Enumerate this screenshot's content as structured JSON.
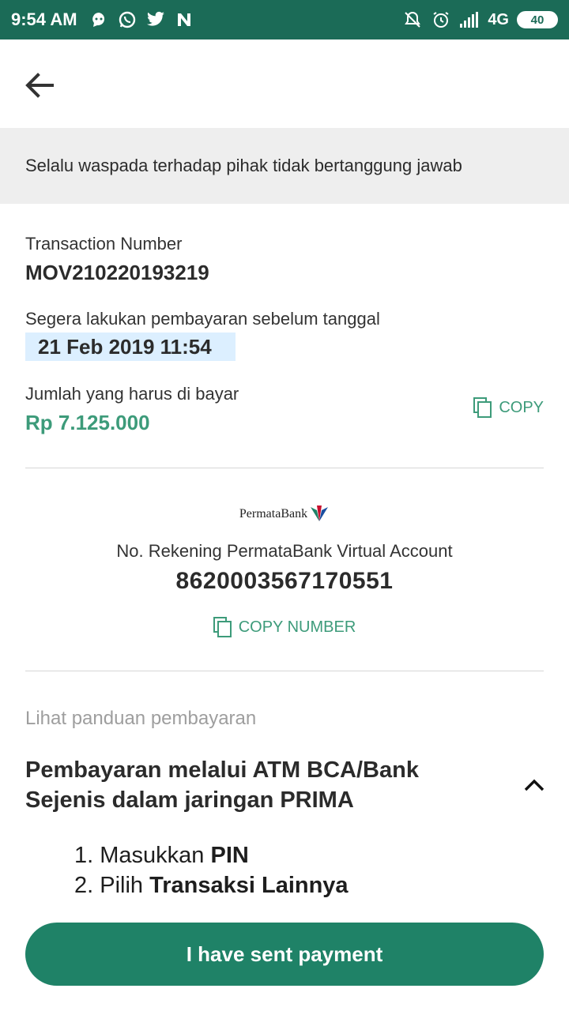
{
  "status_bar": {
    "time": "9:54 AM",
    "network": "4G",
    "battery": "40",
    "left_icons": [
      "chat-icon",
      "whatsapp-icon",
      "twitter-icon",
      "n-app-icon"
    ],
    "right_icons": [
      "notifications-off-icon",
      "alarm-icon",
      "signal-icon"
    ]
  },
  "banner": {
    "text": "Selalu waspada terhadap pihak tidak bertanggung jawab"
  },
  "transaction": {
    "label": "Transaction Number",
    "number": "MOV210220193219"
  },
  "deadline": {
    "label": "Segera lakukan pembayaran sebelum tanggal",
    "date": "21 Feb 2019 11:54"
  },
  "amount": {
    "label": "Jumlah yang harus di bayar",
    "value": "Rp 7.125.000",
    "copy_label": "COPY"
  },
  "bank": {
    "logo_text": "PermataBank",
    "va_label": "No. Rekening PermataBank Virtual Account",
    "va_number": "8620003567170551",
    "copy_number_label": "COPY NUMBER"
  },
  "guide": {
    "label": "Lihat panduan pembayaran",
    "method_title": "Pembayaran melalui ATM BCA/Bank Sejenis dalam jaringan PRIMA",
    "steps": [
      {
        "num": "1.",
        "prefix": "Masukkan ",
        "bold": "PIN"
      },
      {
        "num": "2.",
        "prefix": "Pilih ",
        "bold": "Transaksi Lainnya"
      }
    ]
  },
  "footer": {
    "button_label": "I have sent payment"
  },
  "colors": {
    "status_bar": "#1b6b57",
    "accent_green": "#3d9b7a",
    "button": "#1f8267",
    "banner_bg": "#eeeeee",
    "date_badge": "#dcefff"
  }
}
